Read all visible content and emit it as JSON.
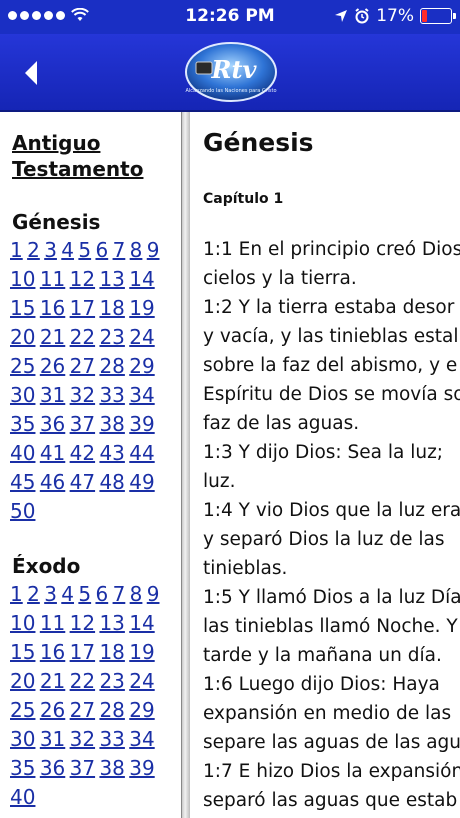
{
  "status": {
    "time": "12:26 PM",
    "battery": "17%",
    "battery_level": 0.17
  },
  "nav": {
    "back_icon": "chevron-left-icon",
    "logo_text": "Rtv",
    "logo_tagline": "Alcanzando las Naciones para Cristo"
  },
  "left": {
    "testament": [
      "Antiguo",
      "Testamento"
    ],
    "books": [
      {
        "name": "Génesis",
        "rows": [
          [
            "1",
            "2",
            "3",
            "4",
            "5",
            "6",
            "7",
            "8",
            "9"
          ],
          [
            "10",
            "11",
            "12",
            "13",
            "14"
          ],
          [
            "15",
            "16",
            "17",
            "18",
            "19"
          ],
          [
            "20",
            "21",
            "22",
            "23",
            "24"
          ],
          [
            "25",
            "26",
            "27",
            "28",
            "29"
          ],
          [
            "30",
            "31",
            "32",
            "33",
            "34"
          ],
          [
            "35",
            "36",
            "37",
            "38",
            "39"
          ],
          [
            "40",
            "41",
            "42",
            "43",
            "44"
          ],
          [
            "45",
            "46",
            "47",
            "48",
            "49"
          ],
          [
            "50"
          ]
        ]
      },
      {
        "name": "Éxodo",
        "rows": [
          [
            "1",
            "2",
            "3",
            "4",
            "5",
            "6",
            "7",
            "8",
            "9"
          ],
          [
            "10",
            "11",
            "12",
            "13",
            "14"
          ],
          [
            "15",
            "16",
            "17",
            "18",
            "19"
          ],
          [
            "20",
            "21",
            "22",
            "23",
            "24"
          ],
          [
            "25",
            "26",
            "27",
            "28",
            "29"
          ],
          [
            "30",
            "31",
            "32",
            "33",
            "34"
          ],
          [
            "35",
            "36",
            "37",
            "38",
            "39"
          ],
          [
            "40"
          ]
        ]
      }
    ]
  },
  "right": {
    "book": "Génesis",
    "chapter": "Capítulo 1",
    "lines": [
      "1:1 En el principio creó Dios",
      "cielos y la tierra.",
      "1:2 Y la tierra estaba desor",
      "y vacía, y las tinieblas estal",
      "sobre la faz del abismo, y e",
      "Espíritu de Dios se movía so",
      "faz de las aguas.",
      "1:3 Y dijo Dios: Sea la luz; ",
      "luz.",
      "1:4 Y vio Dios que la luz era",
      "y separó Dios la luz de las",
      "tinieblas.",
      "1:5 Y llamó Dios a la luz Día",
      "las tinieblas llamó Noche. Y",
      "tarde y la mañana un día.",
      "1:6 Luego dijo Dios: Haya",
      "expansión en medio de las",
      "separe las aguas de las agu",
      "1:7 E hizo Dios la expansión",
      "separó las aguas que estab"
    ]
  }
}
